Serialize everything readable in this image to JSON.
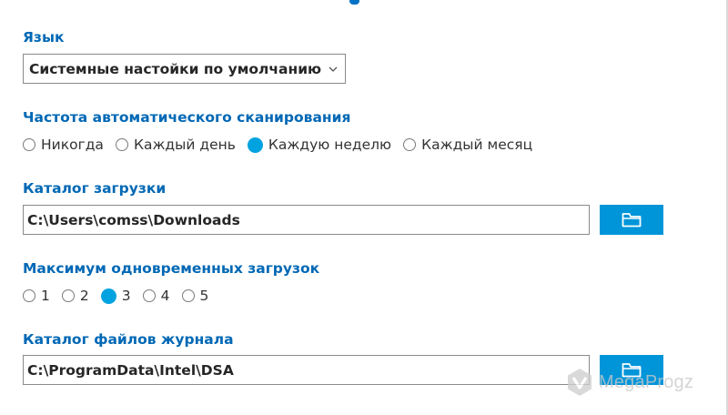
{
  "language": {
    "label": "Язык",
    "selected": "Системные настойки по умолчанию"
  },
  "scan_frequency": {
    "label": "Частота автоматического сканирования",
    "options": [
      {
        "label": "Никогда",
        "selected": false
      },
      {
        "label": "Каждый день",
        "selected": false
      },
      {
        "label": "Каждую неделю",
        "selected": true
      },
      {
        "label": "Каждый месяц",
        "selected": false
      }
    ]
  },
  "download_dir": {
    "label": "Каталог загрузки",
    "value": "C:\\Users\\comss\\Downloads",
    "browse_icon": "folder-icon"
  },
  "max_downloads": {
    "label": "Максимум одновременных загрузок",
    "options": [
      {
        "label": "1",
        "selected": false
      },
      {
        "label": "2",
        "selected": false
      },
      {
        "label": "3",
        "selected": true
      },
      {
        "label": "4",
        "selected": false
      },
      {
        "label": "5",
        "selected": false
      }
    ]
  },
  "log_dir": {
    "label": "Каталог файлов журнала",
    "value": "C:\\ProgramData\\Intel\\DSA",
    "browse_icon": "folder-icon"
  },
  "watermark": {
    "text": "MegaProgz"
  },
  "colors": {
    "label_blue": "#0068b5",
    "accent": "#00a3e0",
    "button": "#0095d9"
  }
}
